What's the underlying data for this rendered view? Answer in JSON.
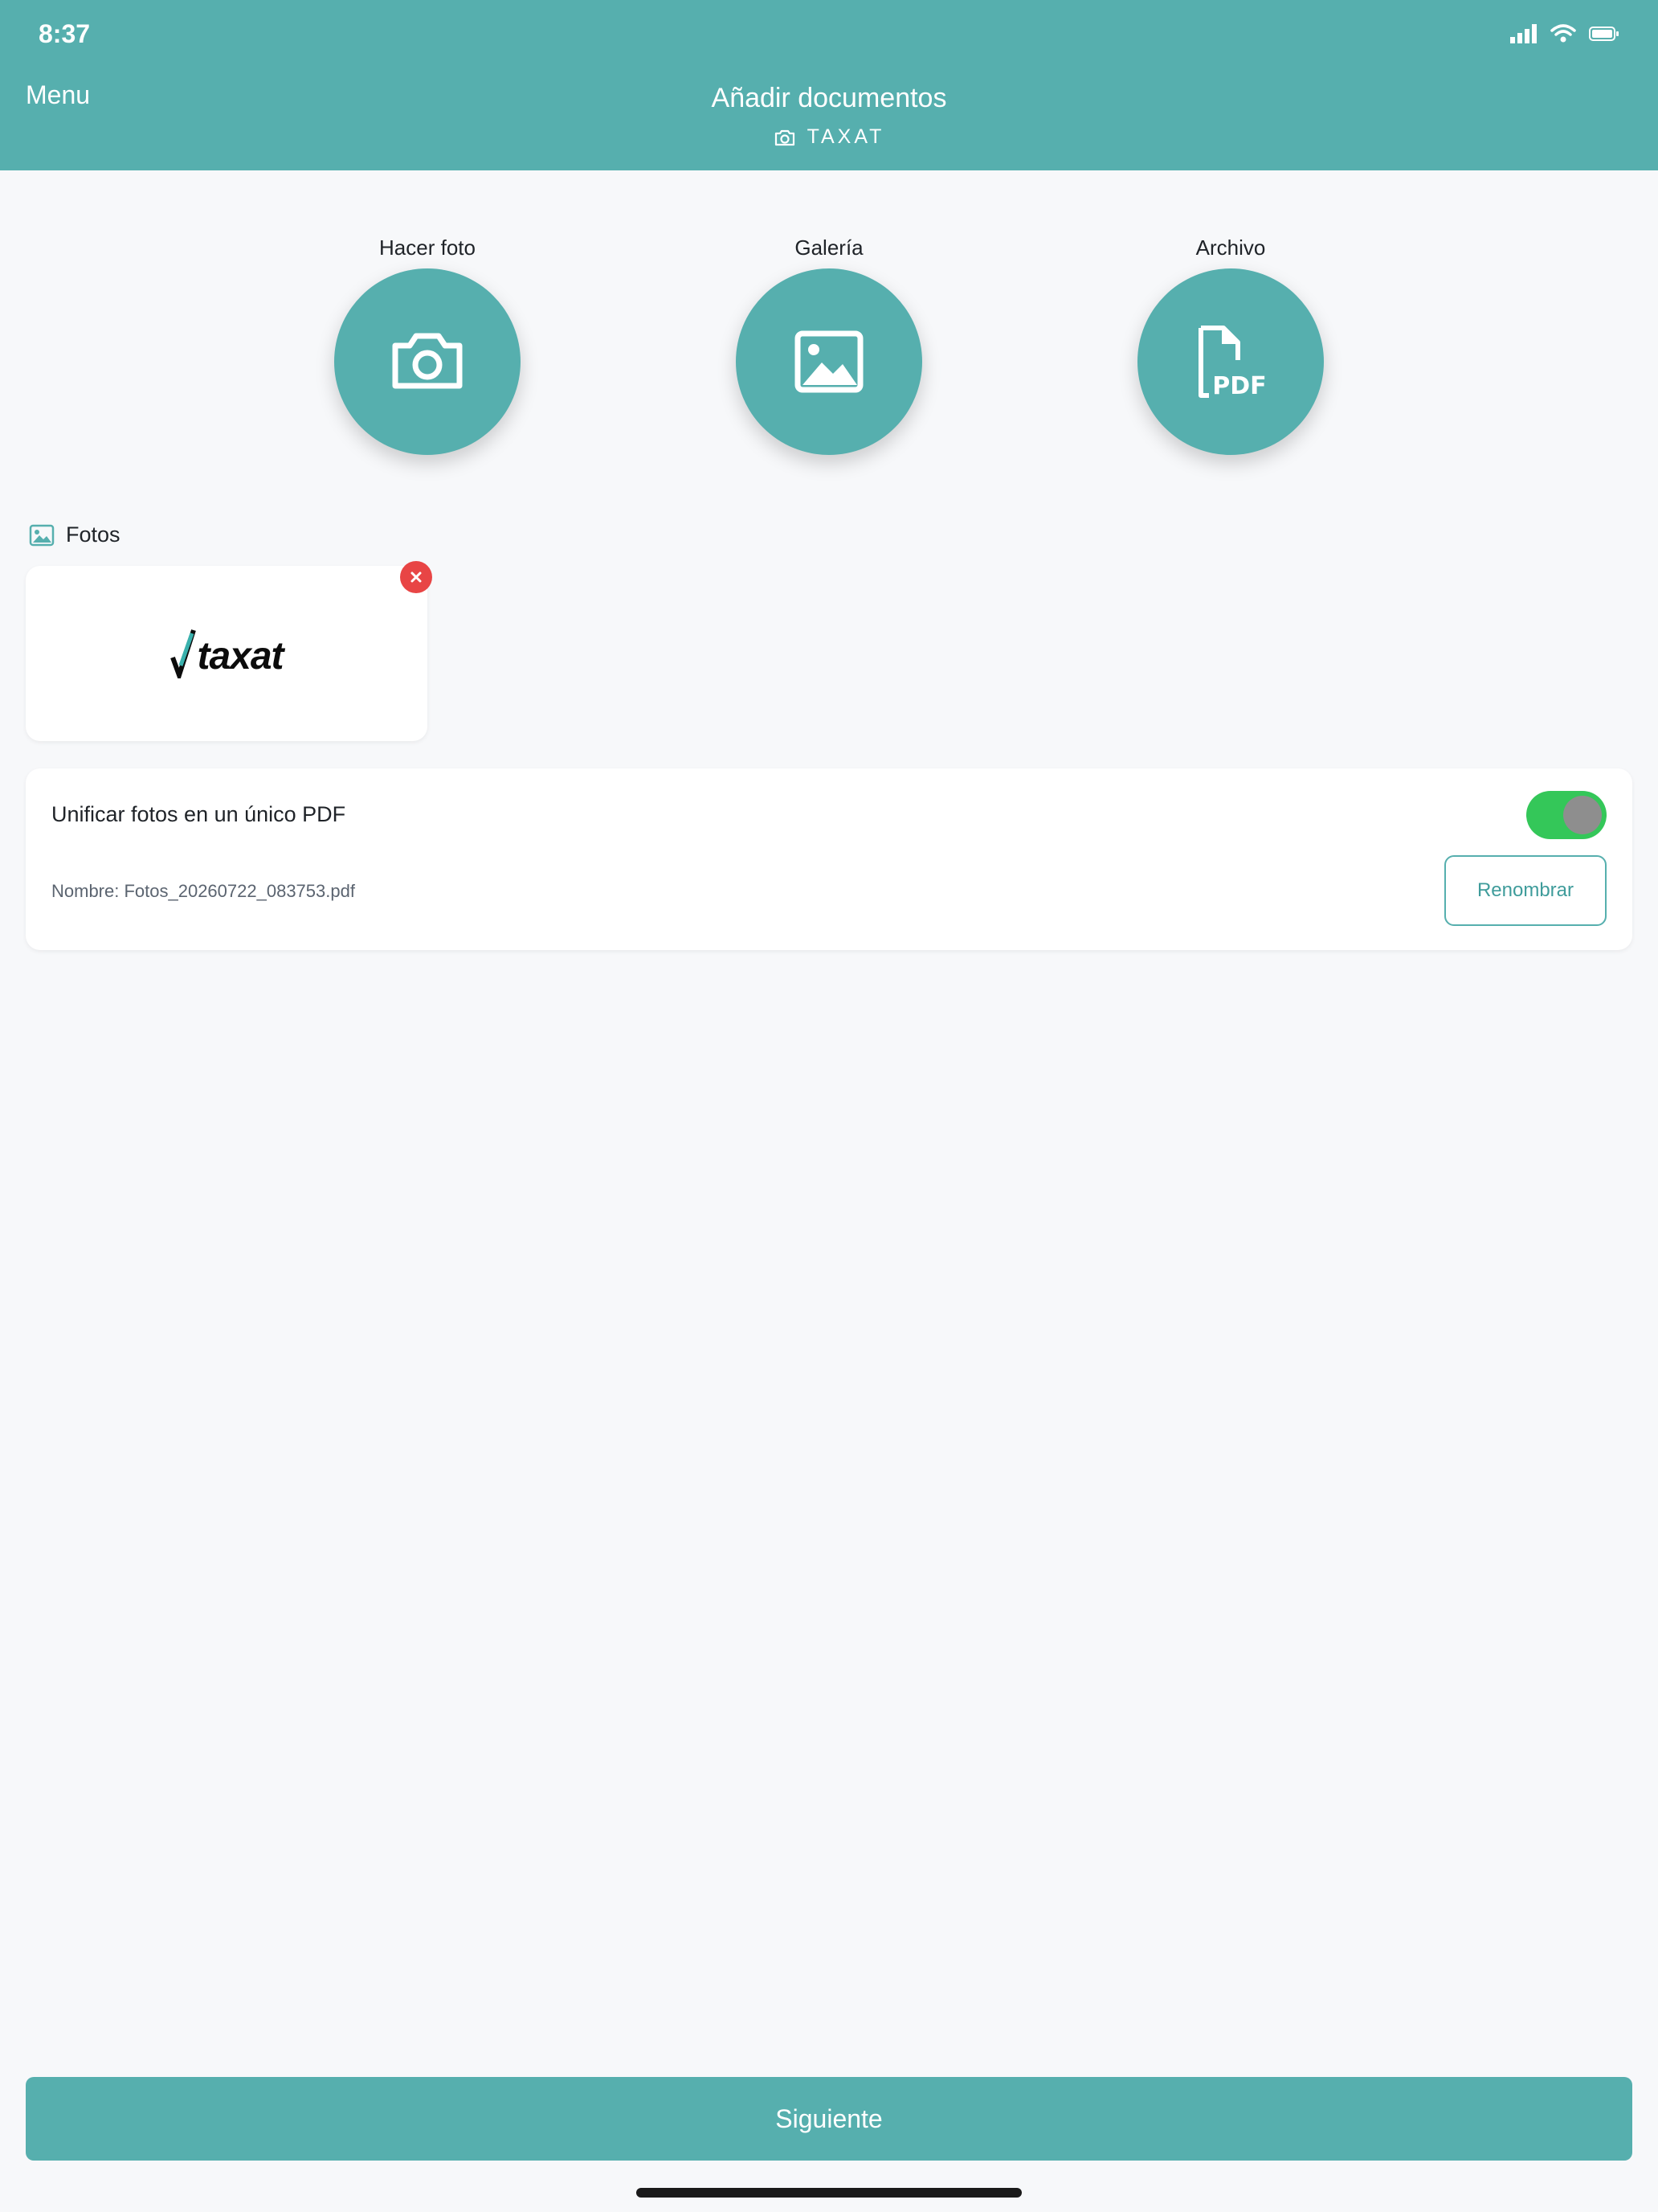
{
  "status_bar": {
    "time": "8:37"
  },
  "header": {
    "menu_label": "Menu",
    "title": "Añadir documentos",
    "subtitle": "TAXAT",
    "background_color": "#56afae"
  },
  "actions": [
    {
      "label": "Hacer foto",
      "icon": "camera-icon"
    },
    {
      "label": "Galería",
      "icon": "image-icon"
    },
    {
      "label": "Archivo",
      "icon": "pdf-file-icon",
      "icon_text": "PDF"
    }
  ],
  "photos": {
    "section_title": "Fotos",
    "items": [
      {
        "logo_text": "taxat",
        "remove_icon": "close-icon"
      }
    ]
  },
  "merge": {
    "label": "Unificar fotos en un único PDF",
    "toggle_on": true,
    "filename": "Nombre: Fotos_20260722_083753.pdf",
    "rename_label": "Renombrar"
  },
  "footer": {
    "next_label": "Siguiente"
  },
  "colors": {
    "accent": "#56afae",
    "toggle_on": "#34c759",
    "danger": "#e84545"
  }
}
